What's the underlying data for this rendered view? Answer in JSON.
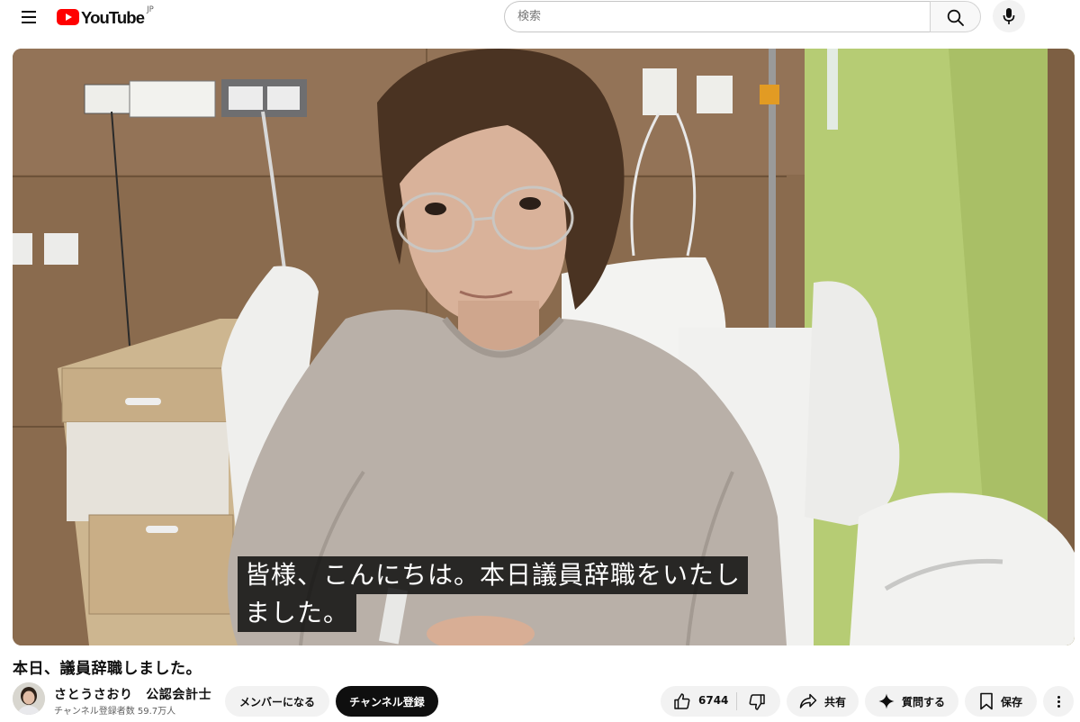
{
  "header": {
    "logo_text": "YouTube",
    "logo_region": "JP",
    "search_placeholder": "検索"
  },
  "player": {
    "caption_lines": [
      "皆様、こんにちは。本日議員辞職をいたし",
      "ました。"
    ]
  },
  "video": {
    "title": "本日、議員辞職しました。"
  },
  "channel": {
    "name": "さとうさおり　公認会計士",
    "subscribers": "チャンネル登録者数 59.7万人"
  },
  "actions": {
    "member_label": "メンバーになる",
    "subscribe_label": "チャンネル登録",
    "like_count": "6744",
    "share_label": "共有",
    "ask_label": "質問する",
    "save_label": "保存"
  },
  "colors": {
    "brand_red": "#ff0000",
    "wall_wood": "#8a6b4e",
    "wall_green": "#b6cc74",
    "sweater": "#b9b0a8"
  }
}
